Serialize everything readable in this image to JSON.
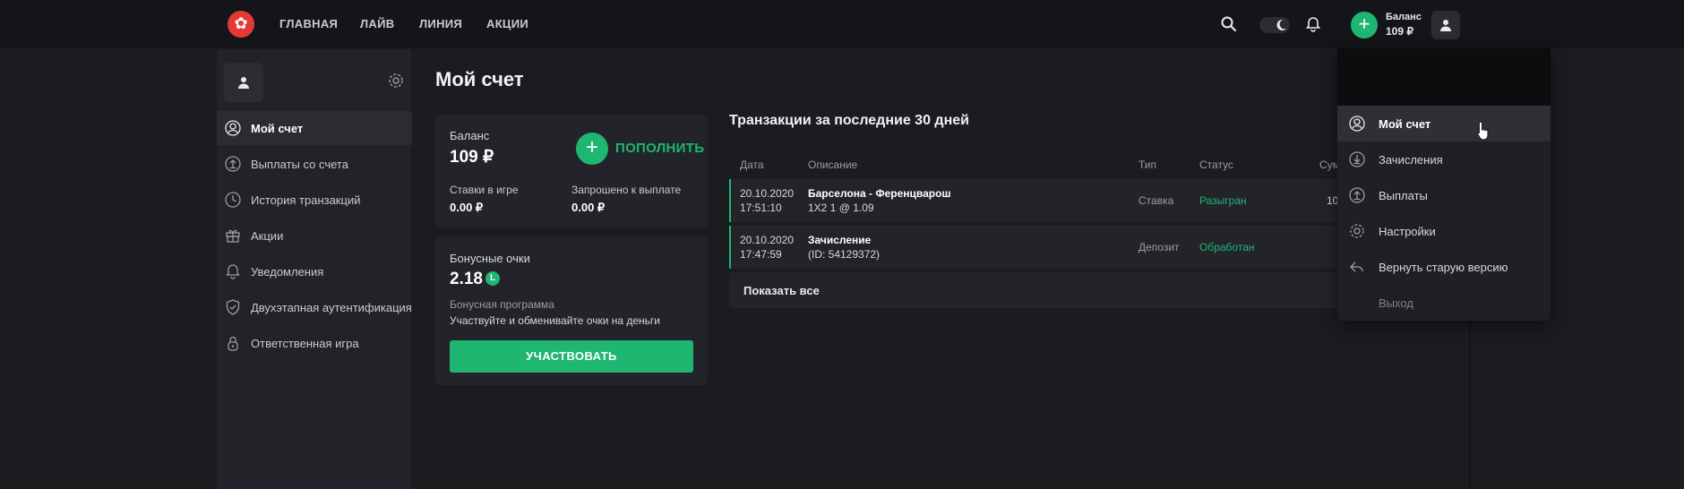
{
  "header": {
    "nav": [
      "ГЛАВНАЯ",
      "ЛАЙВ",
      "ЛИНИЯ",
      "АКЦИИ"
    ],
    "balance_label": "Баланс",
    "balance_value": "109 ₽",
    "add_symbol": "+"
  },
  "sidebar": {
    "items": [
      {
        "label": "Мой счет",
        "icon": "user-circle-icon"
      },
      {
        "label": "Выплаты со счета",
        "icon": "upload-circle-icon"
      },
      {
        "label": "История транзакций",
        "icon": "clock-icon"
      },
      {
        "label": "Акции",
        "icon": "gift-icon"
      },
      {
        "label": "Уведомления",
        "icon": "bell-icon"
      },
      {
        "label": "Двухэтапная аутентификация",
        "icon": "shield-icon"
      },
      {
        "label": "Ответственная игра",
        "icon": "lock-icon"
      }
    ]
  },
  "main": {
    "title": "Мой счет",
    "balance": {
      "label": "Баланс",
      "value": "109 ₽",
      "topup_symbol": "+",
      "topup_label": "ПОПОЛНИТЬ",
      "bets_label": "Ставки в игре",
      "bets_value": "0.00 ₽",
      "requested_label": "Запрошено к выплате",
      "requested_value": "0.00 ₽"
    },
    "bonus": {
      "label": "Бонусные очки",
      "value": "2.18",
      "coin": "L",
      "program_label": "Бонусная программа",
      "program_text": "Участвуйте и обменивайте очки на деньги",
      "button_label": "УЧАСТВОВАТЬ"
    },
    "transactions": {
      "title": "Транзакции за последние 30 дней",
      "columns": [
        "Дата",
        "Описание",
        "Тип",
        "Статус",
        "Сум"
      ],
      "rows": [
        {
          "date": "20.10.2020",
          "time": "17:51:10",
          "desc1": "Барселона - Ференцварош",
          "desc2": "1X2 1 @ 1.09",
          "type": "Ставка",
          "status": "Разыгран",
          "amount": "10"
        },
        {
          "date": "20.10.2020",
          "time": "17:47:59",
          "desc1": "Зачисление",
          "desc2": "(ID: 54129372)",
          "type": "Депозит",
          "status": "Обработан",
          "amount": ""
        }
      ],
      "show_all": "Показать все"
    }
  },
  "dropdown": {
    "items": [
      {
        "label": "Мой счет",
        "icon": "user-circle-icon"
      },
      {
        "label": "Зачисления",
        "icon": "download-circle-icon"
      },
      {
        "label": "Выплаты",
        "icon": "upload-circle-icon"
      },
      {
        "label": "Настройки",
        "icon": "gear-icon"
      },
      {
        "label": "Вернуть старую версию",
        "icon": "reply-arrow-icon"
      },
      {
        "label": "Выход",
        "icon": ""
      }
    ]
  },
  "colors": {
    "accent": "#1fb672",
    "brand": "#e53935",
    "background": "#1b1c20"
  }
}
